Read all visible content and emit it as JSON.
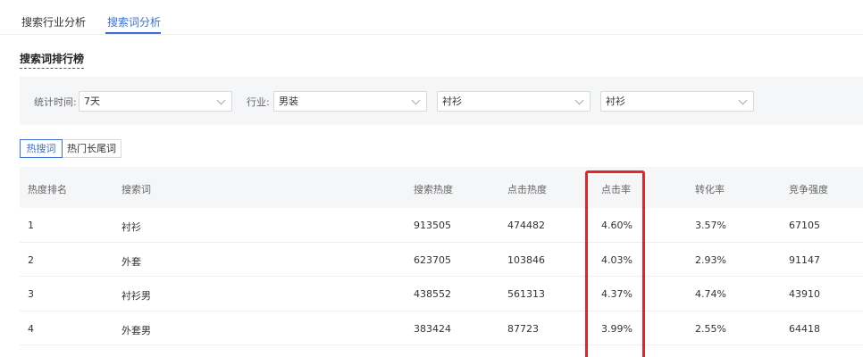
{
  "tabs": [
    {
      "label": "搜索行业分析"
    },
    {
      "label": "搜索词分析"
    }
  ],
  "section_title": "搜索词排行榜",
  "filters": {
    "period_label": "统计时间:",
    "period_value": "7天",
    "industry_label": "行业:",
    "industry_value": "男装",
    "category1_value": "衬衫",
    "category2_value": "衬衫"
  },
  "subtabs": [
    {
      "label": "热搜词"
    },
    {
      "label": "热门长尾词"
    }
  ],
  "table": {
    "headers": [
      "热度排名",
      "搜索词",
      "搜索热度",
      "点击热度",
      "点击率",
      "转化率",
      "竞争强度"
    ],
    "rows": [
      [
        "1",
        "衬衫",
        "913505",
        "474482",
        "4.60%",
        "3.57%",
        "67105"
      ],
      [
        "2",
        "外套",
        "623705",
        "103846",
        "4.03%",
        "2.93%",
        "91147"
      ],
      [
        "3",
        "衬衫男",
        "438552",
        "561313",
        "4.37%",
        "4.74%",
        "43910"
      ],
      [
        "4",
        "外套男",
        "383424",
        "87723",
        "3.99%",
        "2.55%",
        "64418"
      ]
    ]
  },
  "colors": {
    "accent": "#3a6fd8",
    "highlight": "#e0262b"
  }
}
